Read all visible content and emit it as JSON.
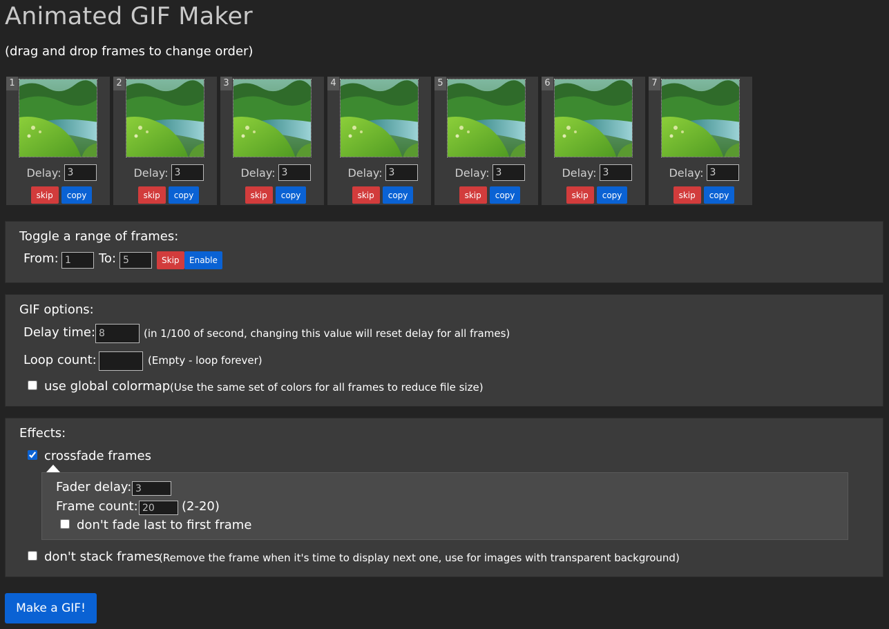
{
  "title": "Animated GIF Maker",
  "subtitle": "(drag and drop frames to change order)",
  "frames": [
    {
      "number": "1",
      "delay_label": "Delay:",
      "delay": "3",
      "skip_label": "skip",
      "copy_label": "copy"
    },
    {
      "number": "2",
      "delay_label": "Delay:",
      "delay": "3",
      "skip_label": "skip",
      "copy_label": "copy"
    },
    {
      "number": "3",
      "delay_label": "Delay:",
      "delay": "3",
      "skip_label": "skip",
      "copy_label": "copy"
    },
    {
      "number": "4",
      "delay_label": "Delay:",
      "delay": "3",
      "skip_label": "skip",
      "copy_label": "copy"
    },
    {
      "number": "5",
      "delay_label": "Delay:",
      "delay": "3",
      "skip_label": "skip",
      "copy_label": "copy"
    },
    {
      "number": "6",
      "delay_label": "Delay:",
      "delay": "3",
      "skip_label": "skip",
      "copy_label": "copy"
    },
    {
      "number": "7",
      "delay_label": "Delay:",
      "delay": "3",
      "skip_label": "skip",
      "copy_label": "copy"
    }
  ],
  "toggle_range": {
    "title": "Toggle a range of frames:",
    "from_label": "From:",
    "from_value": "1",
    "to_label": "To:",
    "to_value": "5",
    "skip_label": "Skip",
    "enable_label": "Enable"
  },
  "gif_options": {
    "title": "GIF options:",
    "delay_label": "Delay time:",
    "delay_value": "8",
    "delay_note": "(in 1/100 of second, changing this value will reset delay for all frames)",
    "loop_label": "Loop count:",
    "loop_value": "",
    "loop_note": "(Empty - loop forever)",
    "colormap_label": "use global colormap",
    "colormap_note": "(Use the same set of colors for all frames to reduce file size)",
    "colormap_checked": false
  },
  "effects": {
    "title": "Effects:",
    "crossfade_label": "crossfade frames",
    "crossfade_checked": true,
    "fader_delay_label": "Fader delay:",
    "fader_delay_value": "3",
    "frame_count_label": "Frame count:",
    "frame_count_value": "20",
    "frame_count_note": "(2-20)",
    "no_fade_label": "don't fade last to first frame",
    "no_fade_checked": false,
    "no_stack_label": "don't stack frames",
    "no_stack_note": "(Remove the frame when it's time to display next one, use for images with transparent background)",
    "no_stack_checked": false
  },
  "make_button_label": "Make a GIF!",
  "colors": {
    "background": "#232323",
    "panel": "#3b3b3b",
    "skip_red": "#d23c3c",
    "copy_blue": "#0a62d4"
  }
}
